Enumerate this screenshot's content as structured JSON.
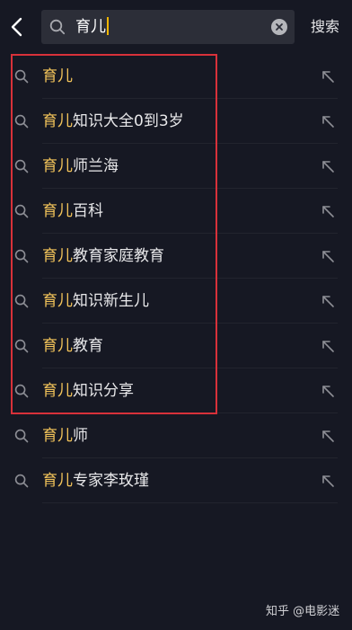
{
  "search": {
    "query": "育儿",
    "action_label": "搜索"
  },
  "suggestions": [
    {
      "highlight": "育儿",
      "rest": ""
    },
    {
      "highlight": "育儿",
      "rest": "知识大全0到3岁"
    },
    {
      "highlight": "育儿",
      "rest": "师兰海"
    },
    {
      "highlight": "育儿",
      "rest": "百科"
    },
    {
      "highlight": "育儿",
      "rest": "教育家庭教育"
    },
    {
      "highlight": "育儿",
      "rest": "知识新生儿"
    },
    {
      "highlight": "育儿",
      "rest": "教育"
    },
    {
      "highlight": "育儿",
      "rest": "知识分享"
    },
    {
      "highlight": "育儿",
      "rest": "师"
    },
    {
      "highlight": "育儿",
      "rest": "专家李玫瑾"
    }
  ],
  "watermark": "知乎 @电影迷",
  "colors": {
    "background": "#161823",
    "search_field": "#2c2e38",
    "query_highlight": "#f2c35a",
    "caret": "#f2b600",
    "annotation_border": "#d8313a"
  }
}
